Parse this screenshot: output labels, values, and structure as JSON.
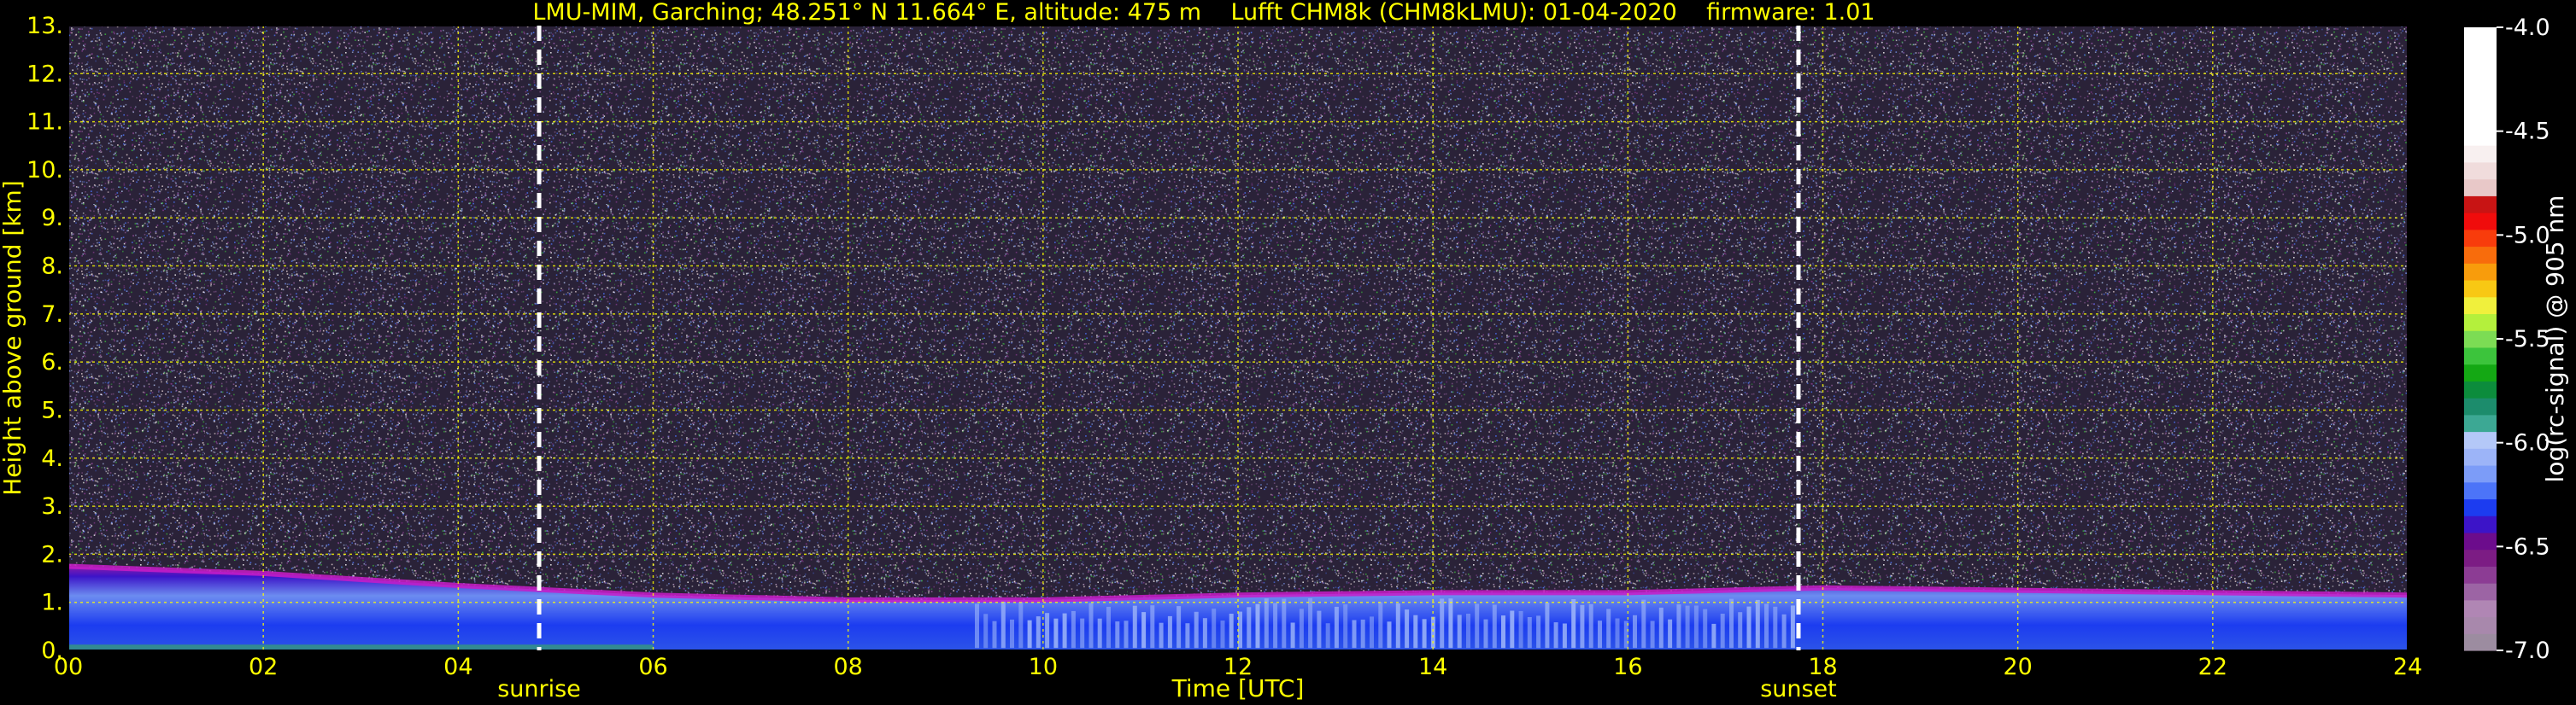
{
  "title_parts": {
    "station": "LMU-MIM, Garching; 48.251° N 11.664° E, altitude: 475 m",
    "instrument": "Lufft CHM8k (CHM8kLMU): 01-04-2020",
    "firmware": "firmware: 1.01"
  },
  "colors": {
    "text": "#ffff00",
    "background": "#000000",
    "grid": "#ffff00",
    "colorbar_text": "#ffffff"
  },
  "chart_data": {
    "type": "heatmap",
    "xlabel": "Time [UTC]",
    "ylabel": "Height above ground [km]",
    "xlim": [
      0,
      24
    ],
    "ylim": [
      0,
      13
    ],
    "x_ticks": [
      "00",
      "02",
      "04",
      "06",
      "08",
      "10",
      "12",
      "14",
      "16",
      "18",
      "20",
      "22",
      "24"
    ],
    "y_ticks": [
      "0.",
      "1.",
      "2.",
      "3.",
      "4.",
      "5.",
      "6.",
      "7.",
      "8.",
      "9.",
      "10.",
      "11.",
      "12.",
      "13."
    ],
    "grid": true,
    "annotations": [
      {
        "label": "sunrise",
        "x": 4.83
      },
      {
        "label": "sunset",
        "x": 17.75
      }
    ],
    "boundary_layer_top_km": [
      {
        "x": 0,
        "y": 1.75
      },
      {
        "x": 2,
        "y": 1.6
      },
      {
        "x": 4,
        "y": 1.35
      },
      {
        "x": 6,
        "y": 1.15
      },
      {
        "x": 8,
        "y": 1.05
      },
      {
        "x": 10,
        "y": 1.05
      },
      {
        "x": 12,
        "y": 1.15
      },
      {
        "x": 14,
        "y": 1.2
      },
      {
        "x": 16,
        "y": 1.2
      },
      {
        "x": 18,
        "y": 1.3
      },
      {
        "x": 20,
        "y": 1.25
      },
      {
        "x": 22,
        "y": 1.2
      },
      {
        "x": 24,
        "y": 1.15
      }
    ],
    "colorbar": {
      "label": "log(rc-signal) @ 905 nm",
      "range": [
        -7.0,
        -4.0
      ],
      "ticks": [
        "-4.0",
        "-4.5",
        "-5.0",
        "-5.5",
        "-6.0",
        "-6.5",
        "-7.0"
      ],
      "colors": [
        "#9c8ca0",
        "#a888ac",
        "#b086b4",
        "#9c64a4",
        "#8c3c94",
        "#7c1c84",
        "#6c0c8c",
        "#3c14c8",
        "#1c3cf0",
        "#4c74f8",
        "#7c9cf8",
        "#9cb4f8",
        "#b4c8f8",
        "#3ca894",
        "#1c8c6c",
        "#0c8c3c",
        "#14a814",
        "#3cc43c",
        "#7cdc54",
        "#b4f03c",
        "#f0f03c",
        "#f8c814",
        "#f89c0c",
        "#f86c0c",
        "#f83c0c",
        "#f00c0c",
        "#c81414",
        "#e8c8c8",
        "#f0dcdc",
        "#f8f0f0",
        "#ffffff",
        "#ffffff",
        "#ffffff",
        "#ffffff",
        "#ffffff",
        "#ffffff",
        "#ffffff"
      ]
    }
  }
}
